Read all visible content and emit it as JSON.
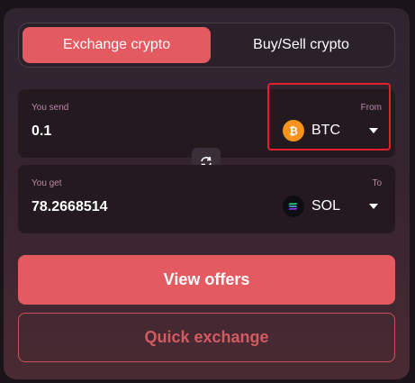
{
  "tabs": [
    {
      "label": "Exchange crypto",
      "active": true
    },
    {
      "label": "Buy/Sell crypto",
      "active": false
    }
  ],
  "send": {
    "caption": "You send",
    "direction_label": "From",
    "amount": "0.1",
    "currency": "BTC",
    "currency_icon": "bitcoin-icon"
  },
  "get": {
    "caption": "You get",
    "direction_label": "To",
    "amount": "78.2668514",
    "currency": "SOL",
    "currency_icon": "solana-icon"
  },
  "swap_icon": "swap-arrows-icon",
  "buttons": {
    "view_offers": "View offers",
    "quick_exchange": "Quick exchange"
  },
  "colors": {
    "accent": "#e35a60",
    "highlight_border": "#e0202a",
    "btc": "#f7931a"
  }
}
